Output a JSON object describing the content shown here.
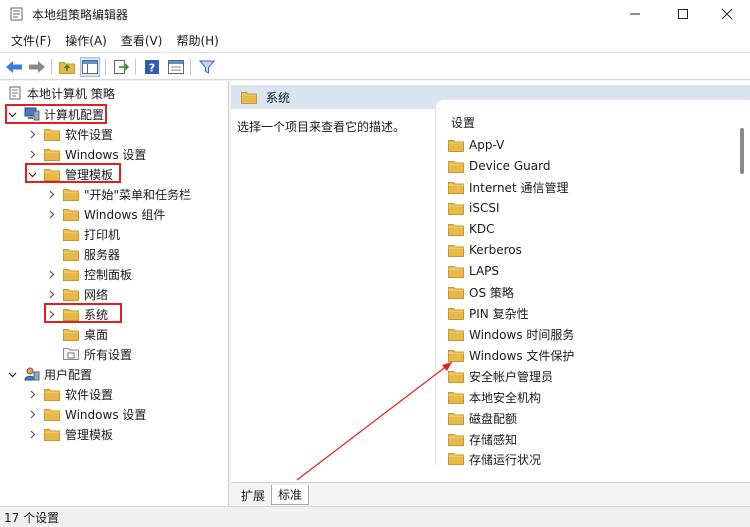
{
  "window": {
    "title": "本地组策略编辑器"
  },
  "menu": [
    "文件(F)",
    "操作(A)",
    "查看(V)",
    "帮助(H)"
  ],
  "toolbar_icons": [
    "back-arrow-icon",
    "forward-arrow-icon",
    "up-folder-icon",
    "show-hide-tree-icon",
    "export-list-icon",
    "help-icon",
    "properties-icon",
    "filter-icon"
  ],
  "tree": {
    "root": "本地计算机 策略",
    "computer_config": "计算机配置",
    "cc_software": "软件设置",
    "cc_windows": "Windows 设置",
    "cc_admin": "管理模板",
    "admin_start": "\"开始\"菜单和任务栏",
    "admin_wincomp": "Windows 组件",
    "admin_printers": "打印机",
    "admin_server": "服务器",
    "admin_control": "控制面板",
    "admin_network": "网络",
    "admin_system": "系统",
    "admin_desktop": "桌面",
    "admin_allsettings": "所有设置",
    "user_config": "用户配置",
    "uc_software": "软件设置",
    "uc_windows": "Windows 设置",
    "uc_admin": "管理模板"
  },
  "right": {
    "header": "系统",
    "description": "选择一个项目来查看它的描述。",
    "list_header": "设置",
    "items": [
      "App-V",
      "Device Guard",
      "Internet 通信管理",
      "iSCSI",
      "KDC",
      "Kerberos",
      "LAPS",
      "OS 策略",
      "PIN 复杂性",
      "Windows 时间服务",
      "Windows 文件保护",
      "安全帐户管理员",
      "本地安全机构",
      "磁盘配额",
      "存储感知",
      "存储运行状况"
    ]
  },
  "tabs": [
    "扩展",
    "标准"
  ],
  "status": "17 个设置",
  "colors": {
    "highlight": "#e0201f",
    "header_bg": "#d9e4f1",
    "folder": "#e8b949"
  }
}
